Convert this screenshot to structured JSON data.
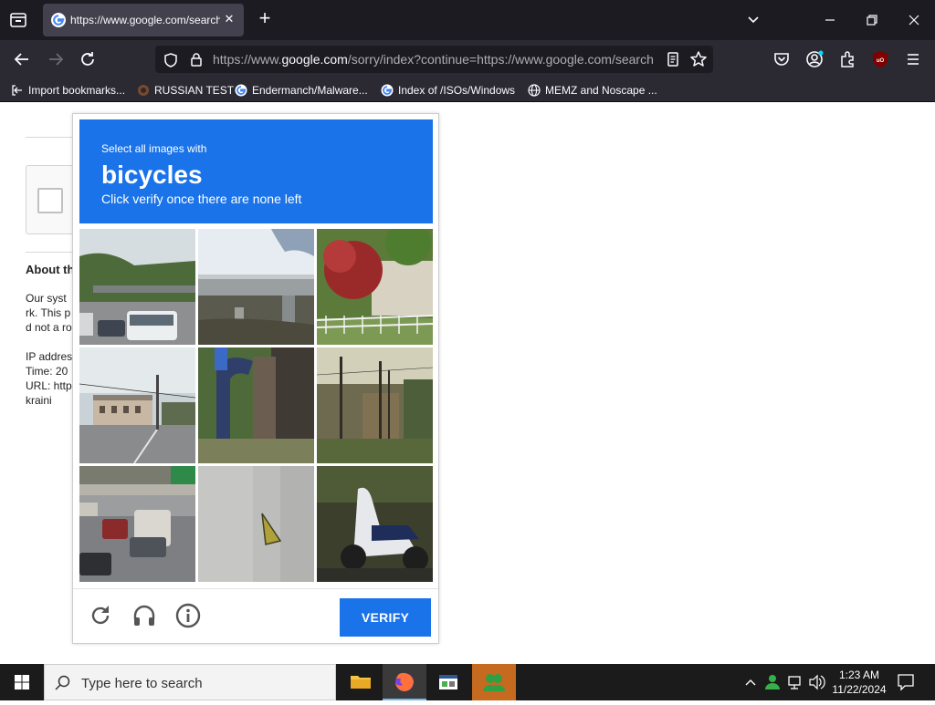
{
  "browser": {
    "tab_title": "https://www.google.com/search",
    "new_tab_symbol": "+",
    "url_prefix": "https://www.",
    "url_domain": "google.com",
    "url_path": "/sorry/index?continue=https://www.google.com/search",
    "bookmarks": [
      {
        "label": "Import bookmarks...",
        "icon": "import-icon"
      },
      {
        "label": "RUSSIAN TEST",
        "icon": "site-icon"
      },
      {
        "label": "Endermanch/Malware...",
        "icon": "google-icon"
      },
      {
        "label": "Index of /ISOs/Windows",
        "icon": "google-icon"
      },
      {
        "label": "MEMZ and Noscape ...",
        "icon": "globe-icon"
      }
    ]
  },
  "page": {
    "about_heading": "About th",
    "lines": [
      "Our syst",
      "rk. This p",
      "d not a ro",
      "",
      "IP addres",
      "Time: 20",
      "URL: http",
      "kraini"
    ]
  },
  "captcha": {
    "instruction_small": "Select all images with",
    "target": "bicycles",
    "instruction_sub": "Click verify once there are none left",
    "verify_label": "VERIFY",
    "accent_color": "#1a73e8"
  },
  "taskbar": {
    "search_placeholder": "Type here to search",
    "time": "1:23 AM",
    "date": "11/22/2024"
  }
}
